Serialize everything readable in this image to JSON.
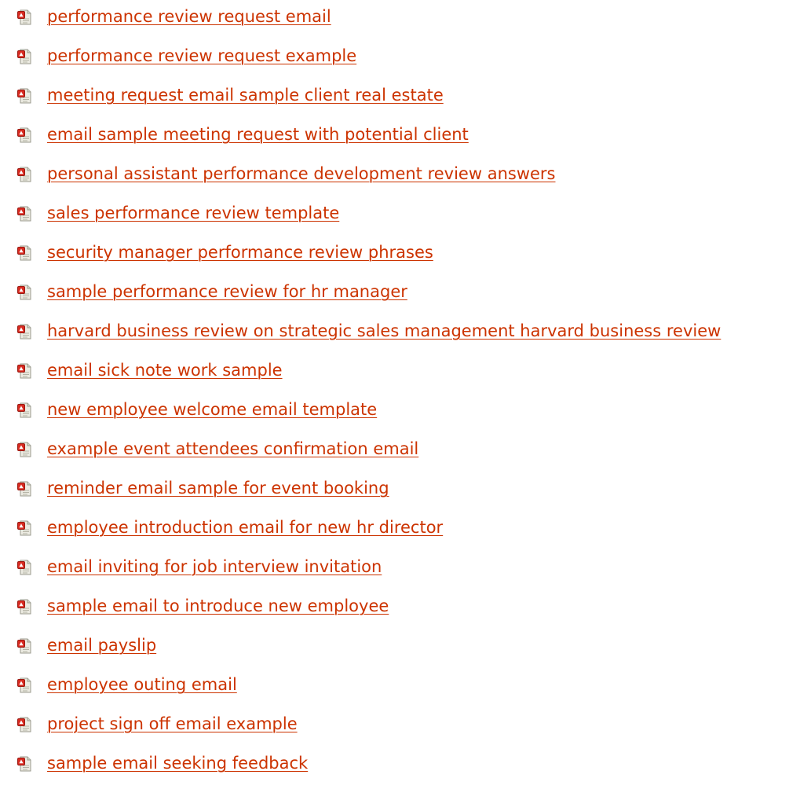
{
  "icon": "pdf-document-icon",
  "colors": {
    "link": "#cc3300",
    "icon_red": "#d82a20",
    "icon_page": "#ecebe2",
    "background": "#ffffff"
  },
  "links": [
    "performance review request email",
    "performance review request example",
    "meeting request email sample client real estate",
    "email sample meeting request with potential client",
    "personal assistant performance development review answers",
    "sales performance review template",
    "security manager performance review phrases",
    "sample performance review for hr manager",
    "harvard business review on strategic sales management harvard business review",
    "email sick note work sample",
    "new employee welcome email template",
    "example event attendees confirmation email",
    "reminder email sample for event booking",
    "employee introduction email for new hr director",
    "email inviting for job interview invitation",
    "sample email to introduce new employee",
    "email payslip",
    "employee outing email",
    "project sign off email example",
    "sample email seeking feedback"
  ]
}
